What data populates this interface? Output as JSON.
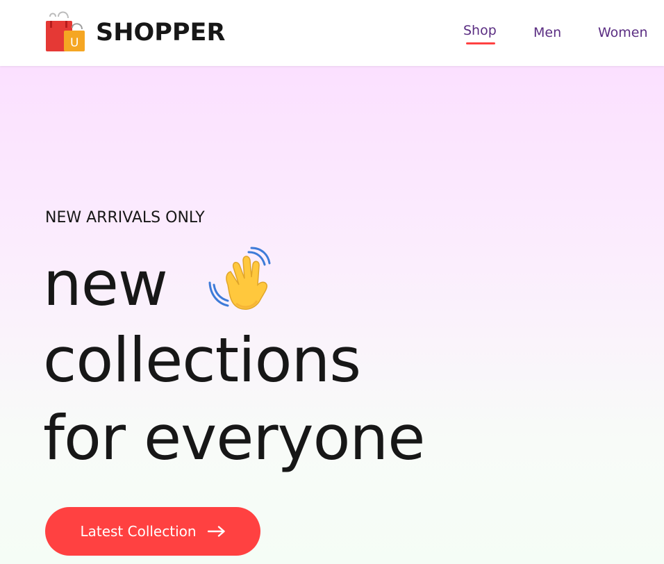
{
  "header": {
    "logo_text": "SHOPPER",
    "logo_icon": "shopping-bag-icon",
    "nav_items": [
      {
        "label": "Shop",
        "active": true
      },
      {
        "label": "Men",
        "active": false
      },
      {
        "label": "Women",
        "active": false
      }
    ]
  },
  "hero": {
    "eyebrow": "NEW ARRIVALS ONLY",
    "headline": [
      "new",
      "collections",
      "for everyone"
    ],
    "wave_icon": "waving-hand-icon",
    "cta_label": "Latest Collection",
    "cta_icon": "arrow-right-icon"
  },
  "colors": {
    "accent": "#ff4141",
    "nav_text": "#5a2d82",
    "text_dark": "#171717",
    "gradient_top": "#fbe0ff",
    "gradient_bottom": "#f5fdf6"
  }
}
